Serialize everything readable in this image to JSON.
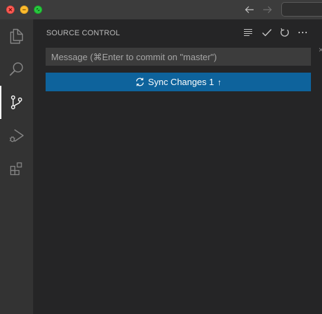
{
  "titlebar": {
    "traffic_lights": [
      "close",
      "minimize",
      "maximize"
    ],
    "nav_back_icon": "arrow-left-icon",
    "nav_forward_icon": "arrow-right-icon"
  },
  "activity_bar": {
    "items": [
      {
        "name": "explorer",
        "icon": "files-icon"
      },
      {
        "name": "search",
        "icon": "search-icon"
      },
      {
        "name": "source-control",
        "icon": "source-control-icon",
        "active": true
      },
      {
        "name": "run-and-debug",
        "icon": "run-debug-icon"
      },
      {
        "name": "extensions",
        "icon": "extensions-icon"
      }
    ]
  },
  "sidebar": {
    "title": "SOURCE CONTROL",
    "toolbar_icons": [
      "view-as-tree-icon",
      "check-icon",
      "refresh-icon",
      "more-icon"
    ],
    "close_glyph": "×"
  },
  "scm": {
    "message_placeholder": "Message (⌘Enter to commit on \"master\")",
    "message_value": "",
    "sync_label": "Sync Changes 1",
    "sync_arrow": "↑"
  },
  "colors": {
    "titlebar": "#3c3c3c",
    "activity_bar": "#333333",
    "sidebar": "#252526",
    "input_background": "#3c3c3c",
    "button_background": "#0e639c",
    "button_text": "#ffffff"
  }
}
